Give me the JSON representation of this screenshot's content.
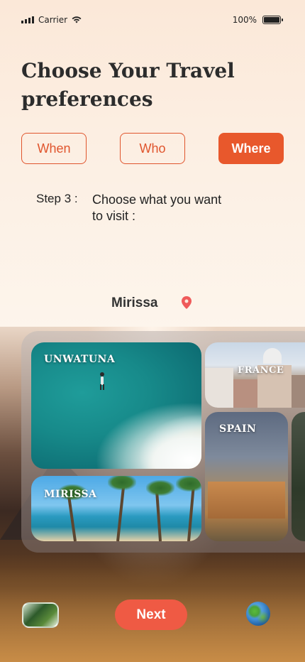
{
  "status_bar": {
    "carrier": "Carrier",
    "battery": "100%"
  },
  "page": {
    "title": "Choose Your Travel preferences"
  },
  "tabs": [
    {
      "label": "When",
      "active": false
    },
    {
      "label": "Who",
      "active": false
    },
    {
      "label": "Where",
      "active": true
    }
  ],
  "step": {
    "label": "Step 3 :",
    "text": "Choose what you want to visit :"
  },
  "location": {
    "name": "Mirissa",
    "icon": "map-pin-icon"
  },
  "destinations": [
    {
      "label": "UNWATUNA"
    },
    {
      "label": "MIRISSA"
    },
    {
      "label": "FRANCE"
    },
    {
      "label": "SPAIN"
    }
  ],
  "nav": {
    "next_label": "Next",
    "left_icon": "landscape-thumbnail-icon",
    "right_icon": "globe-icon"
  },
  "colors": {
    "accent": "#e8582c",
    "next_button": "#ef5a44",
    "pin": "#ef5a5a"
  }
}
